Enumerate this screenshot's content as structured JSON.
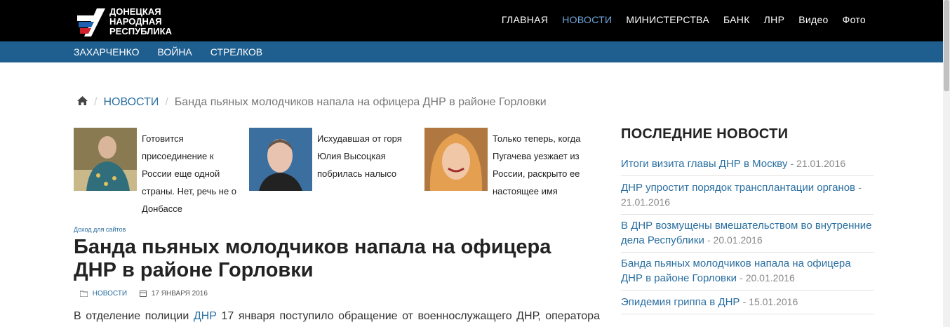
{
  "header": {
    "logo_lines": [
      "ДОНЕЦКАЯ",
      "НАРОДНАЯ",
      "РЕСПУБЛИКА"
    ],
    "nav": [
      {
        "label": "ГЛАВНАЯ",
        "active": false
      },
      {
        "label": "НОВОСТИ",
        "active": true
      },
      {
        "label": "МИНИСТЕРСТВА",
        "active": false
      },
      {
        "label": "БАНК",
        "active": false
      },
      {
        "label": "ЛНР",
        "active": false
      },
      {
        "label": "Видео",
        "active": false
      },
      {
        "label": "Фото",
        "active": false
      }
    ],
    "subnav": [
      "ЗАХАРЧЕНКО",
      "ВОЙНА",
      "СТРЕЛКОВ"
    ]
  },
  "breadcrumb": {
    "section": "НОВОСТИ",
    "current": "Банда пьяных молодчиков напала на офицера ДНР в районе Горловки"
  },
  "related": [
    {
      "caption": "Готовится присоединение к России еще одной страны. Нет, речь не о Донбассе"
    },
    {
      "caption": "Исхудавшая от горя Юлия Высоцкая побрилась налысо"
    },
    {
      "caption": "Только теперь, когда Пугачева уезжает из России, раскрыто ее настоящее имя"
    }
  ],
  "article": {
    "sponsor": "Доход для сайтов",
    "title": "Банда пьяных молодчиков напала на офицера ДНР в районе Горловки",
    "category": "НОВОСТИ",
    "date": "17 ЯНВАРЯ 2016",
    "body_prefix": "В отделение полиции",
    "body_link": "ДНР",
    "body_suffix": "17 января поступило обращение от военнослужащего ДНР, оператора"
  },
  "sidebar": {
    "heading": "ПОСЛЕДНИЕ НОВОСТИ",
    "items": [
      {
        "title": "Итоги визита главы ДНР в Москву",
        "date": "- 21.01.2016"
      },
      {
        "title": "ДНР упростит порядок трансплантации органов",
        "date": "- 21.01.2016"
      },
      {
        "title": "В ДНР возмущены вмешательством во внутренние дела Республики",
        "date": "- 20.01.2016"
      },
      {
        "title": "Банда пьяных молодчиков напала на офицера ДНР в районе Горловки",
        "date": "- 20.01.2016"
      },
      {
        "title": "Эпидемия гриппа в ДНР",
        "date": "- 15.01.2016"
      }
    ]
  },
  "colors": {
    "header_bg": "#000000",
    "subbar_bg": "#1f5f90",
    "link": "#2a6fa0",
    "nav_active": "#6fa8dc"
  }
}
